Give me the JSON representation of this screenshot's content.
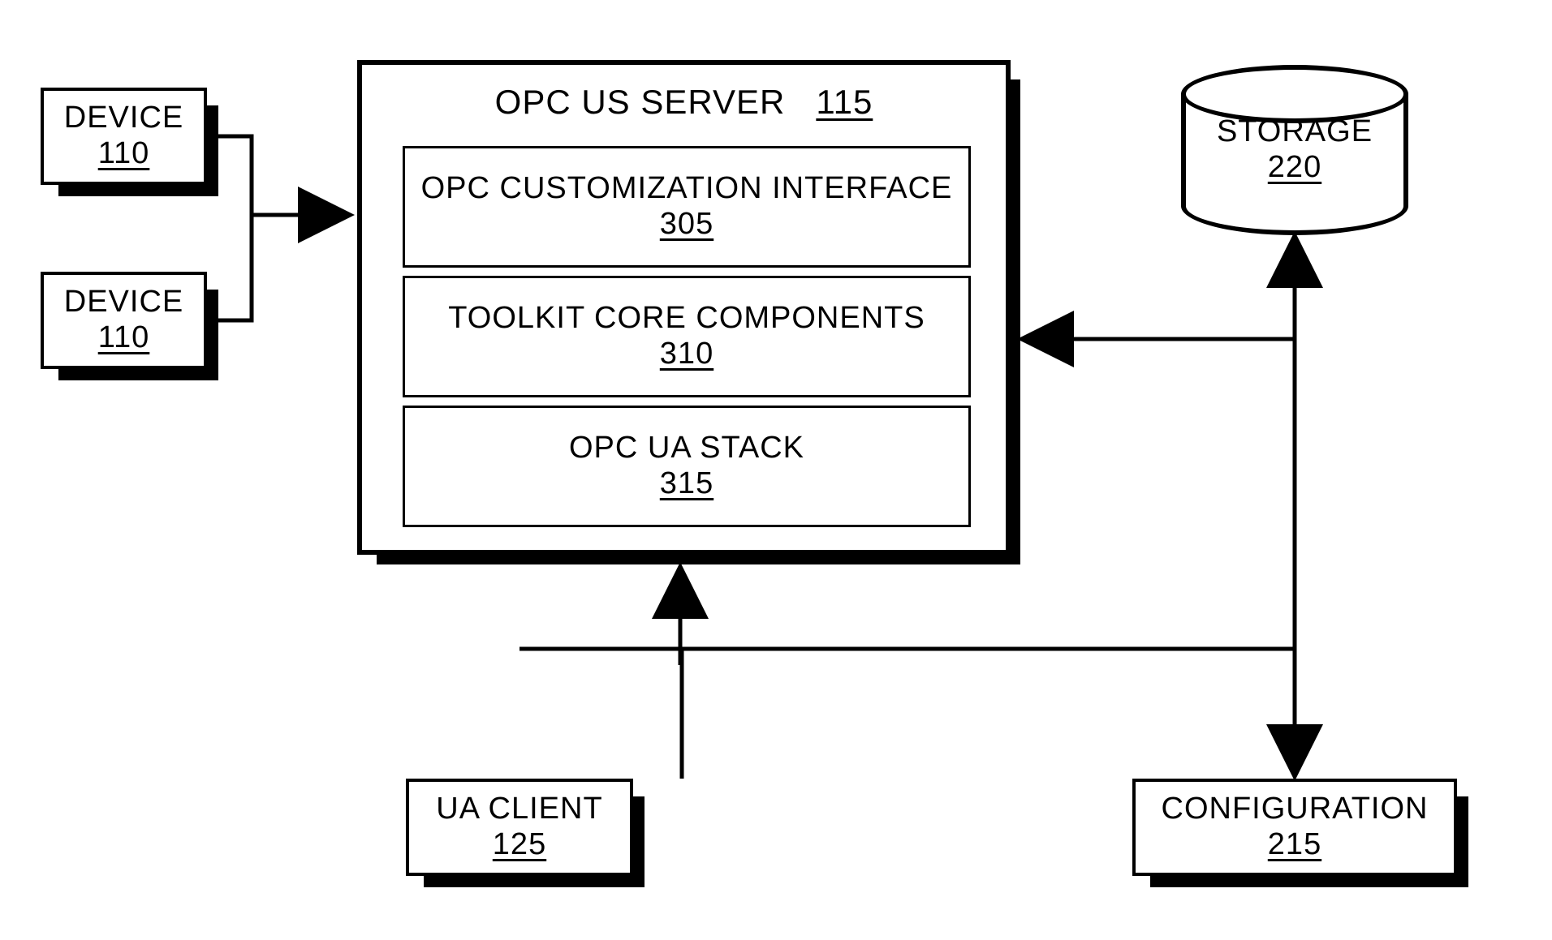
{
  "device1": {
    "label": "DEVICE",
    "num": "110"
  },
  "device2": {
    "label": "DEVICE",
    "num": "110"
  },
  "server": {
    "title_name": "OPC US SERVER",
    "title_num": "115"
  },
  "inner1": {
    "label": "OPC CUSTOMIZATION INTERFACE",
    "num": "305"
  },
  "inner2": {
    "label": "TOOLKIT CORE COMPONENTS",
    "num": "310"
  },
  "inner3": {
    "label": "OPC UA STACK",
    "num": "315"
  },
  "storage": {
    "label": "STORAGE",
    "num": "220"
  },
  "ua": {
    "label": "UA CLIENT",
    "num": "125"
  },
  "config": {
    "label": "CONFIGURATION",
    "num": "215"
  }
}
